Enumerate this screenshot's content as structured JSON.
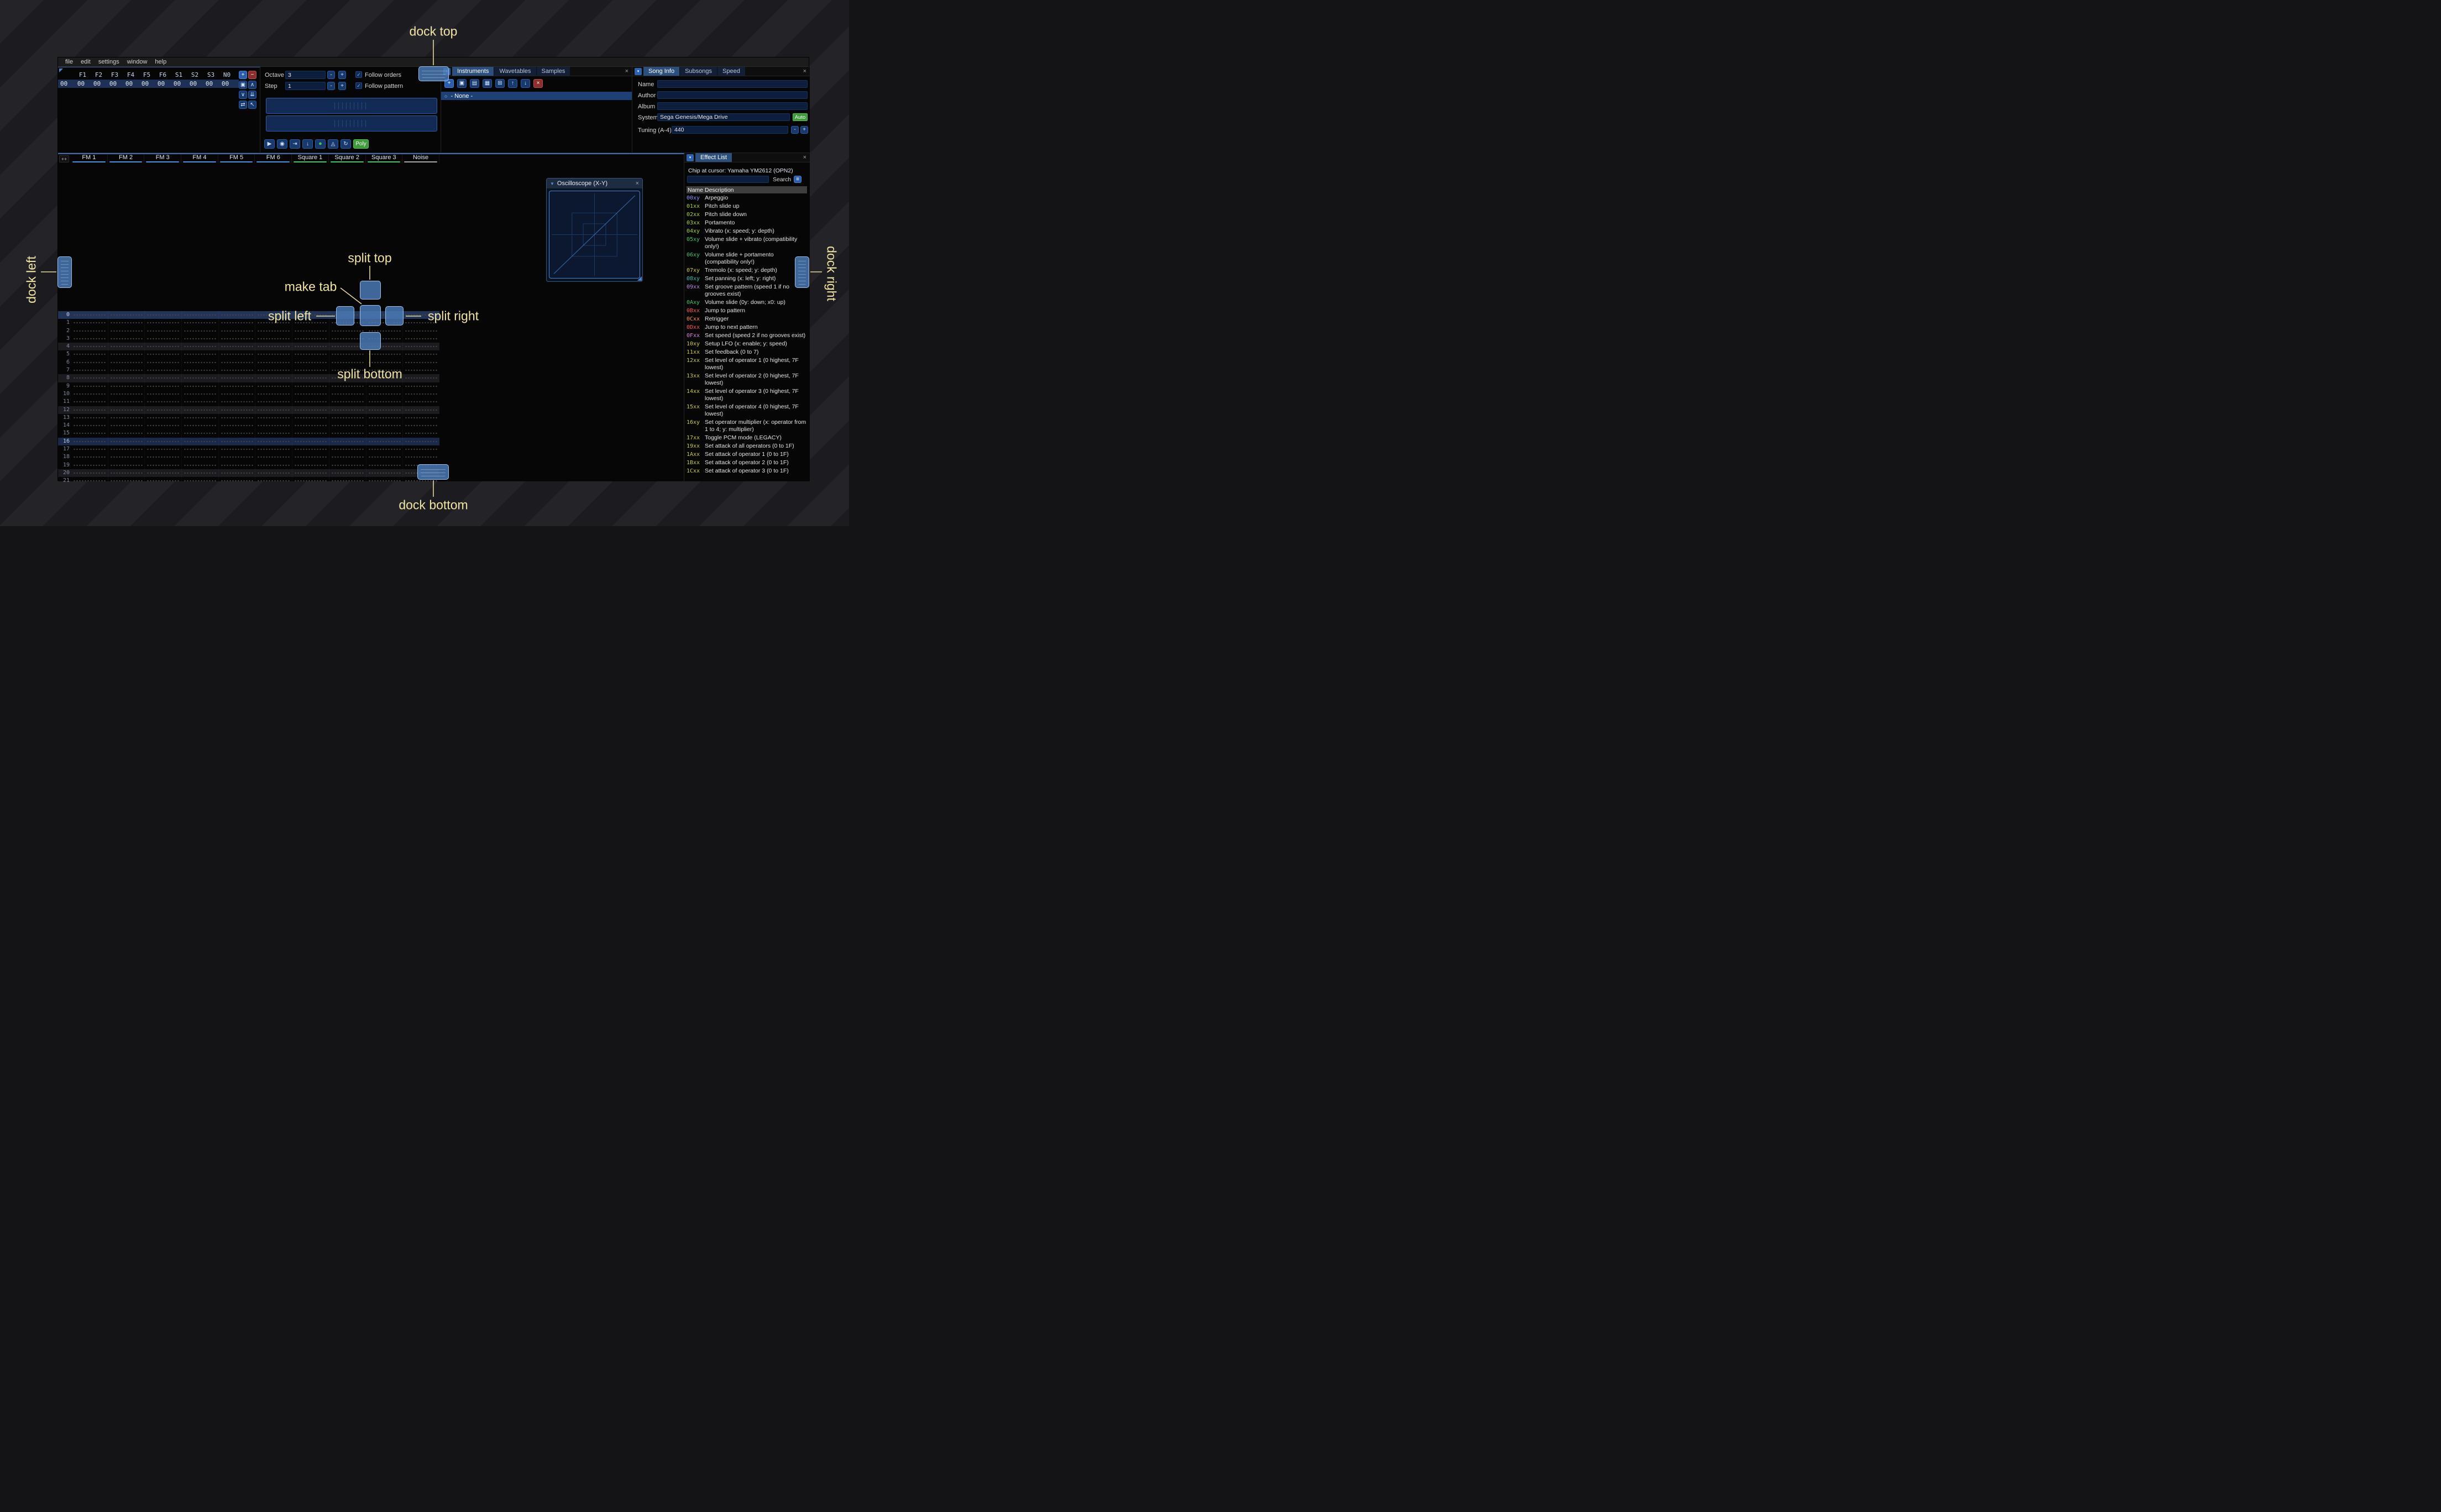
{
  "menu_bar": {
    "items": [
      "file",
      "edit",
      "settings",
      "window",
      "help"
    ]
  },
  "icons": {
    "add": "+",
    "remove": "−",
    "clone": "▣",
    "up": "∧",
    "down": "∨",
    "double_down": "⇊",
    "swap": "⇄",
    "pointer": "↖",
    "play": "▶",
    "play_pattern": "◉",
    "play_once": "⇥",
    "step_row": "↓",
    "record": "●",
    "metronome": "◬",
    "repeat": "↻",
    "open": "▤",
    "save": "▦",
    "sitemap": "⊞",
    "move_up": "↑",
    "move_down": "↓",
    "delete": "×",
    "dropdown": "▾",
    "close": "×",
    "check": "✓",
    "menu": "≡",
    "collapse": "▼",
    "bullet": "○",
    "dec": "-",
    "inc": "+"
  },
  "orders": {
    "channels": [
      "F1",
      "F2",
      "F3",
      "F4",
      "F5",
      "F6",
      "S1",
      "S2",
      "S3",
      "N0"
    ],
    "row_label": "00",
    "row_values": [
      "00",
      "00",
      "00",
      "00",
      "00",
      "00",
      "00",
      "00",
      "00",
      "00"
    ]
  },
  "play_controls": {
    "octave_label": "Octave",
    "octave_value": "3",
    "step_label": "Step",
    "step_value": "1",
    "follow_orders": "Follow orders",
    "follow_pattern": "Follow pattern",
    "poly": "Poly"
  },
  "instruments": {
    "tabs": [
      "Instruments",
      "Wavetables",
      "Samples"
    ],
    "list_item": "- None -"
  },
  "song_info": {
    "tabs": [
      "Song Info",
      "Subsongs",
      "Speed"
    ],
    "name_label": "Name",
    "name_value": "",
    "author_label": "Author",
    "author_value": "",
    "album_label": "Album",
    "album_value": "",
    "system_label": "System",
    "system_value": "Sega Genesis/Mega Drive",
    "auto_button": "Auto",
    "tuning_label": "Tuning (A-4)",
    "tuning_value": "440"
  },
  "pattern": {
    "expand": "++",
    "type_colors": {
      "fm": "#4f8fdf",
      "square": "#45c367",
      "noise": "#a8a8a8"
    },
    "channels": [
      {
        "name": "FM 1",
        "type": "fm"
      },
      {
        "name": "FM 2",
        "type": "fm"
      },
      {
        "name": "FM 3",
        "type": "fm"
      },
      {
        "name": "FM 4",
        "type": "fm"
      },
      {
        "name": "FM 5",
        "type": "fm"
      },
      {
        "name": "FM 6",
        "type": "fm"
      },
      {
        "name": "Square 1",
        "type": "square"
      },
      {
        "name": "Square 2",
        "type": "square"
      },
      {
        "name": "Square 3",
        "type": "square"
      },
      {
        "name": "Noise",
        "type": "noise"
      }
    ],
    "rows": [
      "0",
      "1",
      "2",
      "3",
      "4",
      "5",
      "6",
      "7",
      "8",
      "9",
      "10",
      "11",
      "12",
      "13",
      "14",
      "15",
      "16",
      "17",
      "18",
      "19",
      "20",
      "21"
    ]
  },
  "oscilloscope": {
    "title": "Oscilloscope (X-Y)"
  },
  "effect_list": {
    "tab": "Effect List",
    "chip": "Chip at cursor: Yamaha YM2612 (OPN2)",
    "search_label": "Search",
    "search_value": "",
    "col_name": "Name",
    "col_desc": "Description",
    "effects": [
      {
        "code": "00xy",
        "desc": "Arpeggio",
        "color": "#9090ff"
      },
      {
        "code": "01xx",
        "desc": "Pitch slide up",
        "color": "#a9d23a"
      },
      {
        "code": "02xx",
        "desc": "Pitch slide down",
        "color": "#a9d23a"
      },
      {
        "code": "03xx",
        "desc": "Portamento",
        "color": "#a9d23a"
      },
      {
        "code": "04xy",
        "desc": "Vibrato (x: speed; y: depth)",
        "color": "#a9d23a"
      },
      {
        "code": "05xy",
        "desc": "Volume slide + vibrato (compatibility only!)",
        "color": "#3ec46a"
      },
      {
        "code": "06xy",
        "desc": "Volume slide + portamento (compatibility only!)",
        "color": "#3ec46a"
      },
      {
        "code": "07xy",
        "desc": "Tremolo (x: speed; y: depth)",
        "color": "#c9cc41"
      },
      {
        "code": "08xy",
        "desc": "Set panning (x: left; y: right)",
        "color": "#33bfae"
      },
      {
        "code": "09xx",
        "desc": "Set groove pattern (speed 1 if no grooves exist)",
        "color": "#b88ae6"
      },
      {
        "code": "0Axy",
        "desc": "Volume slide (0y: down; x0: up)",
        "color": "#3ec46a"
      },
      {
        "code": "0Bxx",
        "desc": "Jump to pattern",
        "color": "#ff5454"
      },
      {
        "code": "0Cxx",
        "desc": "Retrigger",
        "color": "#ff8c4a"
      },
      {
        "code": "0Dxx",
        "desc": "Jump to next pattern",
        "color": "#ff5454"
      },
      {
        "code": "0Fxx",
        "desc": "Set speed (speed 2 if no grooves exist)",
        "color": "#d981d9"
      },
      {
        "code": "10xy",
        "desc": "Setup LFO (x: enable; y: speed)",
        "color": "#c9cc41"
      },
      {
        "code": "11xx",
        "desc": "Set feedback (0 to 7)",
        "color": "#c9cc41"
      },
      {
        "code": "12xx",
        "desc": "Set level of operator 1 (0 highest, 7F lowest)",
        "color": "#c9cc41"
      },
      {
        "code": "13xx",
        "desc": "Set level of operator 2 (0 highest, 7F lowest)",
        "color": "#c9cc41"
      },
      {
        "code": "14xx",
        "desc": "Set level of operator 3 (0 highest, 7F lowest)",
        "color": "#c9cc41"
      },
      {
        "code": "15xx",
        "desc": "Set level of operator 4 (0 highest, 7F lowest)",
        "color": "#c9cc41"
      },
      {
        "code": "16xy",
        "desc": "Set operator multiplier (x: operator from 1 to 4; y: multiplier)",
        "color": "#c9cc41"
      },
      {
        "code": "17xx",
        "desc": "Toggle PCM mode (LEGACY)",
        "color": "#c9cc41"
      },
      {
        "code": "19xx",
        "desc": "Set attack of all operators (0 to 1F)",
        "color": "#c9cc41"
      },
      {
        "code": "1Axx",
        "desc": "Set attack of operator 1 (0 to 1F)",
        "color": "#c9cc41"
      },
      {
        "code": "1Bxx",
        "desc": "Set attack of operator 2 (0 to 1F)",
        "color": "#c9cc41"
      },
      {
        "code": "1Cxx",
        "desc": "Set attack of operator 3 (0 to 1F)",
        "color": "#c9cc41"
      }
    ]
  },
  "annotations": {
    "dock_top": "dock top",
    "dock_bottom": "dock bottom",
    "dock_left": "dock left",
    "dock_right": "dock right",
    "split_top": "split top",
    "split_bottom": "split bottom",
    "split_left": "split left",
    "split_right": "split right",
    "make_tab": "make tab"
  }
}
